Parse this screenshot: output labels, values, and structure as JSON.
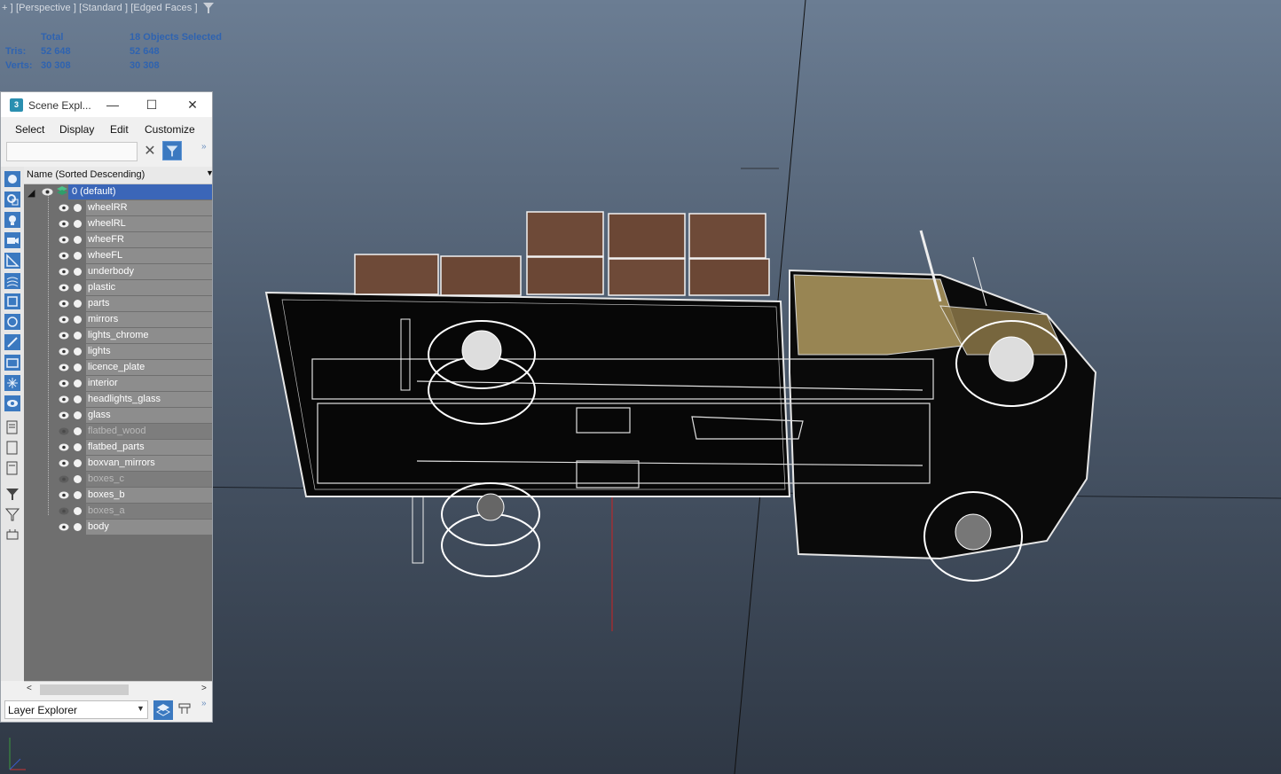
{
  "viewport": {
    "label": "+ ] [Perspective ] [Standard ] [Edged Faces ]",
    "stats": {
      "header_total": "Total",
      "header_selected": "18 Objects Selected",
      "tris_label": "Tris:",
      "tris_total": "52 648",
      "tris_selected": "52 648",
      "verts_label": "Verts:",
      "verts_total": "30 308",
      "verts_selected": "30 308"
    },
    "model_icons": [
      "filter-icon",
      "axis-gizmo-icon"
    ]
  },
  "explorer": {
    "title": "Scene Expl...",
    "app_icon": "3",
    "window_buttons": {
      "minimize": "—",
      "maximize": "☐",
      "close": "✕"
    },
    "menus": [
      "Select",
      "Display",
      "Edit",
      "Customize"
    ],
    "search_value": "",
    "column_header": "Name (Sorted Descending)",
    "root_layer": "0 (default)",
    "items": [
      {
        "name": "wheelRR",
        "visible": true
      },
      {
        "name": "wheelRL",
        "visible": true
      },
      {
        "name": "wheeFR",
        "visible": true
      },
      {
        "name": "wheeFL",
        "visible": true
      },
      {
        "name": "underbody",
        "visible": true
      },
      {
        "name": "plastic",
        "visible": true
      },
      {
        "name": "parts",
        "visible": true
      },
      {
        "name": "mirrors",
        "visible": true
      },
      {
        "name": "lights_chrome",
        "visible": true
      },
      {
        "name": "lights",
        "visible": true
      },
      {
        "name": "licence_plate",
        "visible": true
      },
      {
        "name": "interior",
        "visible": true
      },
      {
        "name": "headlights_glass",
        "visible": true
      },
      {
        "name": "glass",
        "visible": true
      },
      {
        "name": "flatbed_wood",
        "visible": false
      },
      {
        "name": "flatbed_parts",
        "visible": true
      },
      {
        "name": "boxvan_mirrors",
        "visible": true
      },
      {
        "name": "boxes_c",
        "visible": false
      },
      {
        "name": "boxes_b",
        "visible": true
      },
      {
        "name": "boxes_a",
        "visible": false
      },
      {
        "name": "body",
        "visible": true
      }
    ],
    "layer_explorer": "Layer Explorer",
    "colors": {
      "selection": "#3b66b8",
      "accent_button": "#3b79c0",
      "stats_text": "#2f63b0"
    }
  }
}
